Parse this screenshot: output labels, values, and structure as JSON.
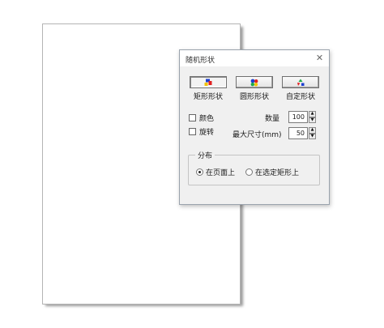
{
  "dialog": {
    "title": "随机形状",
    "close_glyph": "✕",
    "shape_buttons": [
      {
        "label": "矩形形状",
        "icon": "rectangles-icon",
        "pressed": true
      },
      {
        "label": "圆形形状",
        "icon": "circles-icon",
        "pressed": false
      },
      {
        "label": "自定形状",
        "icon": "custom-shapes-icon",
        "pressed": false
      }
    ],
    "options": {
      "color_label": "颜色",
      "color_checked": false,
      "rotate_label": "旋转",
      "rotate_checked": false
    },
    "quantity": {
      "label": "数量",
      "value": "100"
    },
    "max_size": {
      "label": "最大尺寸(mm)",
      "value": "50"
    },
    "distribution": {
      "title": "分布",
      "options": [
        {
          "label": "在页面上",
          "checked": true
        },
        {
          "label": "在选定矩形上",
          "checked": false
        }
      ]
    },
    "spin_up": "▲",
    "spin_down": "▼"
  },
  "colors": {
    "red": "#e02020",
    "blue": "#1c3fd0",
    "yellow": "#f2c200",
    "green": "#1aa84a"
  }
}
